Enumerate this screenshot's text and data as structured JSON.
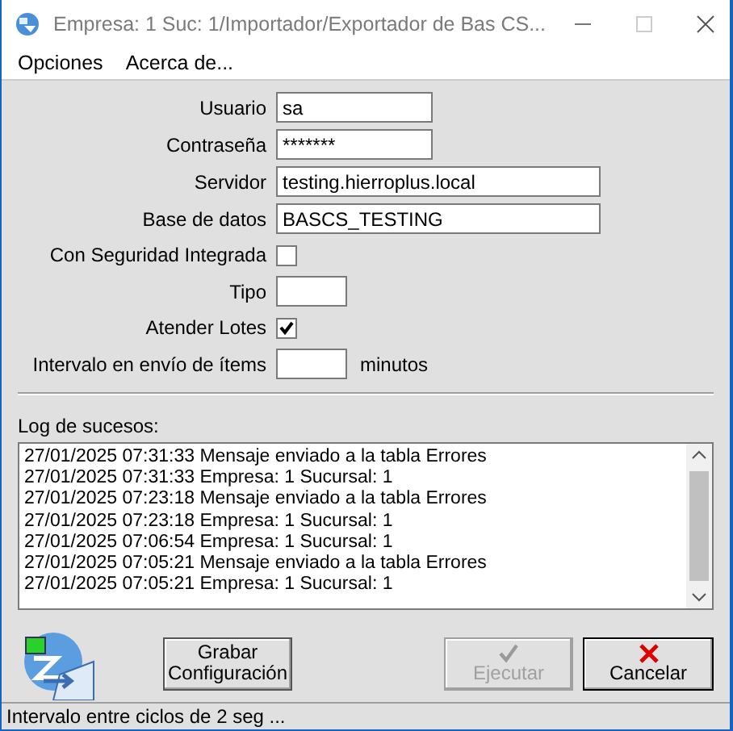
{
  "window": {
    "title": "Empresa: 1 Suc: 1/Importador/Exportador de Bas CS..."
  },
  "menu": [
    "Opciones",
    "Acerca de..."
  ],
  "form": [
    {
      "kind": "short",
      "label": "Usuario",
      "value": "sa"
    },
    {
      "kind": "short",
      "label": "Contraseña",
      "value": "*******"
    },
    {
      "kind": "long",
      "label": "Servidor",
      "value": "testing.hierroplus.local"
    },
    {
      "kind": "long",
      "label": "Base de datos",
      "value": "BASCS_TESTING"
    },
    {
      "kind": "check",
      "label": "Con Seguridad Integrada",
      "checked": false
    },
    {
      "kind": "tiny",
      "label": "Tipo"
    },
    {
      "kind": "check",
      "label": "Atender Lotes",
      "checked": true
    },
    {
      "kind": "tiny",
      "label": "Intervalo en envío de ítems",
      "suffix": "minutos"
    }
  ],
  "log": {
    "label": "Log de sucesos:",
    "lines": [
      "27/01/2025 07:31:33 Mensaje enviado a la tabla Errores",
      "27/01/2025 07:31:33 Empresa: 1 Sucursal: 1",
      "27/01/2025 07:23:18 Mensaje enviado a la tabla Errores",
      "27/01/2025 07:23:18 Empresa: 1 Sucursal: 1",
      "27/01/2025 07:06:54 Empresa: 1 Sucursal: 1",
      "27/01/2025 07:05:21 Mensaje enviado a la tabla Errores",
      "27/01/2025 07:05:21 Empresa: 1 Sucursal: 1"
    ]
  },
  "buttons": [
    {
      "kind": "save",
      "label": "Grabar\nConfiguración",
      "disabled": false
    },
    {
      "kind": "run",
      "label": "Ejecutar",
      "disabled": true
    },
    {
      "kind": "cancel",
      "label": "Cancelar",
      "disabled": false
    }
  ],
  "status_bar": "Intervalo entre ciclos de 2 seg ..."
}
